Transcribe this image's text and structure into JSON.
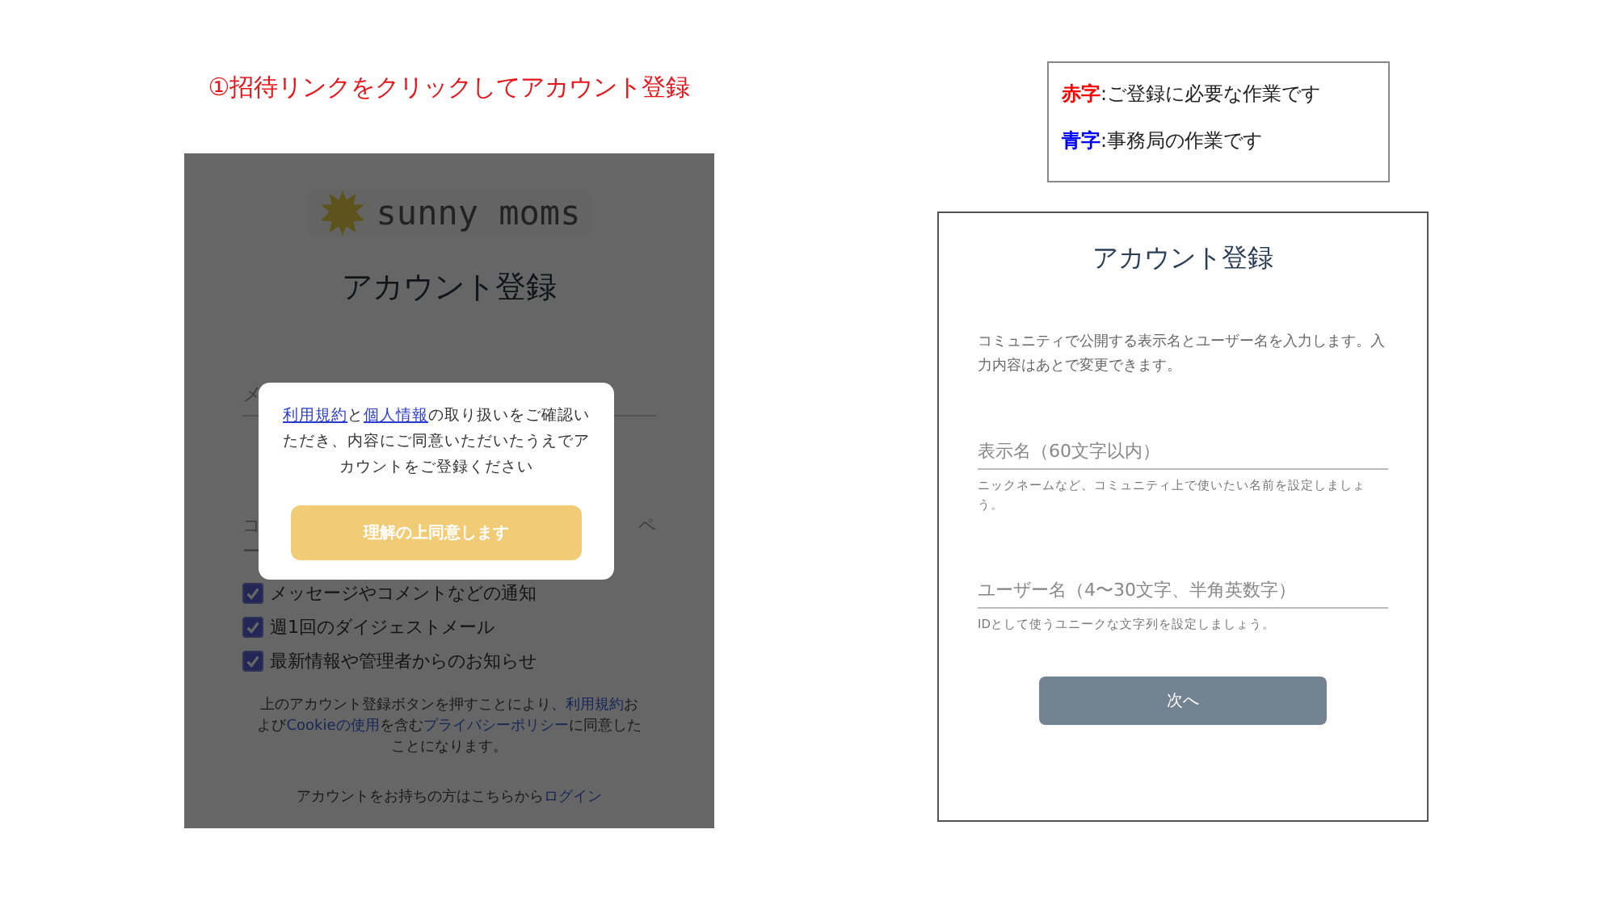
{
  "step_caption": "①招待リンクをクリックしてアカウント登録",
  "legend": [
    {
      "key": "赤字",
      "text": ":ご登録に必要な作業です",
      "color": "#ff0000"
    },
    {
      "key": "青字",
      "text": ":事務局の作業です",
      "color": "#0000ff"
    }
  ],
  "signup_screen": {
    "logo_text": "sunny moms",
    "title": "アカウント登録",
    "field_placeholder": "メ",
    "notice_fragments": {
      "line_1_start": "コ",
      "line_1_end": "ペ",
      "line_2_start": "ー"
    },
    "checkboxes": [
      {
        "label": "メッセージやコメントなどの通知",
        "checked": true
      },
      {
        "label": "週1回のダイジェストメール",
        "checked": true
      },
      {
        "label": "最新情報や管理者からのお知らせ",
        "checked": true
      }
    ],
    "terms": [
      {
        "kind": "text",
        "text": "上のアカウント登録ボタンを押すことにより、"
      },
      {
        "kind": "link",
        "text": "利用規約"
      },
      {
        "kind": "text",
        "text": "および"
      },
      {
        "kind": "link",
        "text": "Cookieの使用"
      },
      {
        "kind": "text",
        "text": "を含む"
      },
      {
        "kind": "link",
        "text": "プライバシーポリシー"
      },
      {
        "kind": "text",
        "text": "に同意したことになります。"
      }
    ],
    "login": [
      {
        "kind": "text",
        "text": "アカウントをお持ちの方はこちらから"
      },
      {
        "kind": "link",
        "text": "ログイン"
      }
    ],
    "modal": {
      "message": [
        {
          "kind": "link",
          "text": "利用規約"
        },
        {
          "kind": "text",
          "text": "と"
        },
        {
          "kind": "link",
          "text": "個人情報"
        },
        {
          "kind": "text",
          "text": "の取り扱いをご確認いただき、内容にご同意いただいたうえでアカウントをご登録ください"
        }
      ],
      "button": "理解の上同意します"
    }
  },
  "profile_screen": {
    "title": "アカウント登録",
    "description": "コミュニティで公開する表示名とユーザー名を入力します。入力内容はあとで変更できます。",
    "fields": [
      {
        "placeholder": "表示名（60文字以内）",
        "help": "ニックネームなど、コミュニティ上で使いたい名前を設定しましょう。"
      },
      {
        "placeholder": "ユーザー名（4〜30文字、半角英数字）",
        "help": "IDとして使うユニークな文字列を設定しましょう。"
      }
    ],
    "button": "次へ"
  }
}
